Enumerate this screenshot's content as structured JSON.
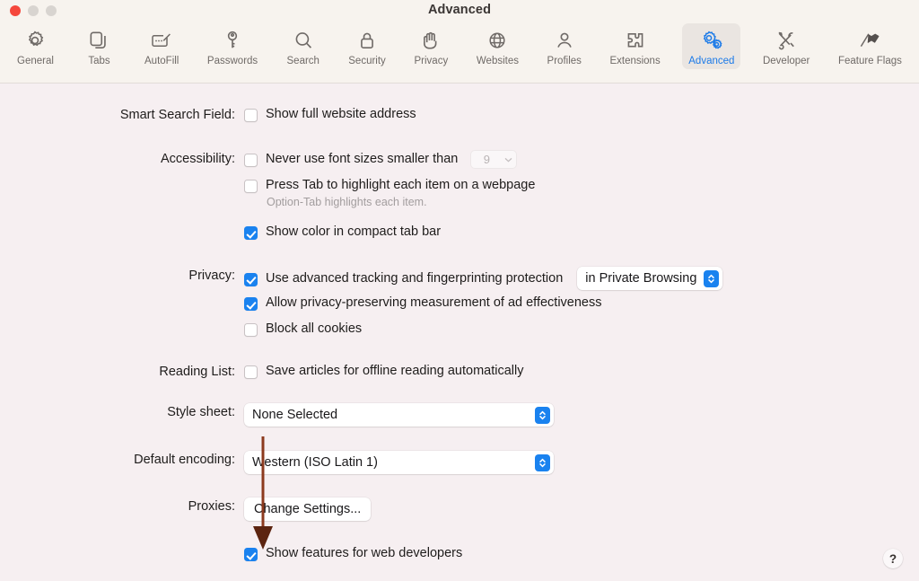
{
  "window": {
    "title": "Advanced",
    "traffic_lights": [
      "close",
      "minimize",
      "zoom"
    ]
  },
  "toolbar": {
    "items": [
      {
        "label": "General",
        "icon": "gear-icon",
        "selected": false
      },
      {
        "label": "Tabs",
        "icon": "tabs-icon",
        "selected": false
      },
      {
        "label": "AutoFill",
        "icon": "autofill-icon",
        "selected": false
      },
      {
        "label": "Passwords",
        "icon": "key-icon",
        "selected": false
      },
      {
        "label": "Search",
        "icon": "search-icon",
        "selected": false
      },
      {
        "label": "Security",
        "icon": "lock-icon",
        "selected": false
      },
      {
        "label": "Privacy",
        "icon": "hand-icon",
        "selected": false
      },
      {
        "label": "Websites",
        "icon": "globe-icon",
        "selected": false
      },
      {
        "label": "Profiles",
        "icon": "person-icon",
        "selected": false
      },
      {
        "label": "Extensions",
        "icon": "puzzle-icon",
        "selected": false
      },
      {
        "label": "Advanced",
        "icon": "gears-icon",
        "selected": true
      },
      {
        "label": "Developer",
        "icon": "tools-icon",
        "selected": false
      },
      {
        "label": "Feature Flags",
        "icon": "flags-icon",
        "selected": false
      }
    ],
    "selected_accent": "#1b7ae8",
    "selected_background": "#eae5e1"
  },
  "settings": {
    "smart_search_field": {
      "label": "Smart Search Field:",
      "show_full_website_address": {
        "label": "Show full website address",
        "checked": false
      }
    },
    "accessibility": {
      "label": "Accessibility:",
      "never_use_font_sizes": {
        "label": "Never use font sizes smaller than",
        "checked": false,
        "size_value": "9",
        "size_disabled": true
      },
      "press_tab": {
        "label": "Press Tab to highlight each item on a webpage",
        "checked": false
      },
      "press_tab_hint": "Option-Tab highlights each item.",
      "show_color_compact_tab_bar": {
        "label": "Show color in compact tab bar",
        "checked": true
      }
    },
    "privacy": {
      "label": "Privacy:",
      "advanced_tracking": {
        "label": "Use advanced tracking and fingerprinting protection",
        "checked": true,
        "scope_value": "in Private Browsing"
      },
      "ad_effectiveness": {
        "label": "Allow privacy-preserving measurement of ad effectiveness",
        "checked": true
      },
      "block_all_cookies": {
        "label": "Block all cookies",
        "checked": false
      }
    },
    "reading_list": {
      "label": "Reading List:",
      "save_articles": {
        "label": "Save articles for offline reading automatically",
        "checked": false
      }
    },
    "style_sheet": {
      "label": "Style sheet:",
      "value": "None Selected"
    },
    "default_encoding": {
      "label": "Default encoding:",
      "value": "Western (ISO Latin 1)"
    },
    "proxies": {
      "label": "Proxies:",
      "button_label": "Change Settings..."
    },
    "web_developers": {
      "label": "Show features for web developers",
      "checked": true
    }
  },
  "help": {
    "label": "?"
  },
  "annotation": {
    "type": "arrow",
    "color": "#8c3a1e",
    "points_to": "show-features-for-web-developers-checkbox"
  }
}
